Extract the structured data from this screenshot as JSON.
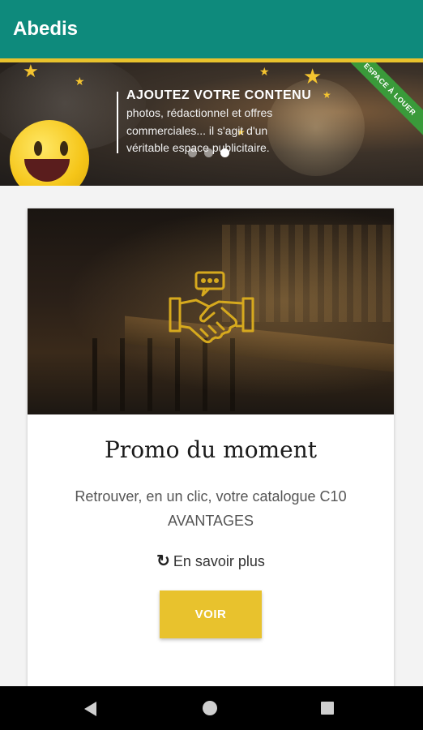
{
  "app": {
    "title": "Abedis"
  },
  "colors": {
    "primary": "#0e8a7c",
    "accent": "#e8c22d"
  },
  "banner": {
    "heading": "AJOUTEZ VOTRE CONTENU",
    "lines": [
      "photos, rédactionnel et offres",
      "commerciales... il s'agit d'un",
      "véritable espace publicitaire."
    ],
    "ribbon": "ESPACE À LOUER",
    "carousel_index": 3,
    "carousel_count": 3
  },
  "card": {
    "icon": "handshake-icon",
    "title": "Promo du moment",
    "description": "Retrouver, en un clic, votre catalogue C10 AVANTAGES",
    "more_link": "En savoir plus",
    "more_icon": "refresh-icon",
    "button_label": "VOIR"
  },
  "navigation": {
    "back": "back-icon",
    "home": "home-icon",
    "recents": "recents-icon"
  }
}
